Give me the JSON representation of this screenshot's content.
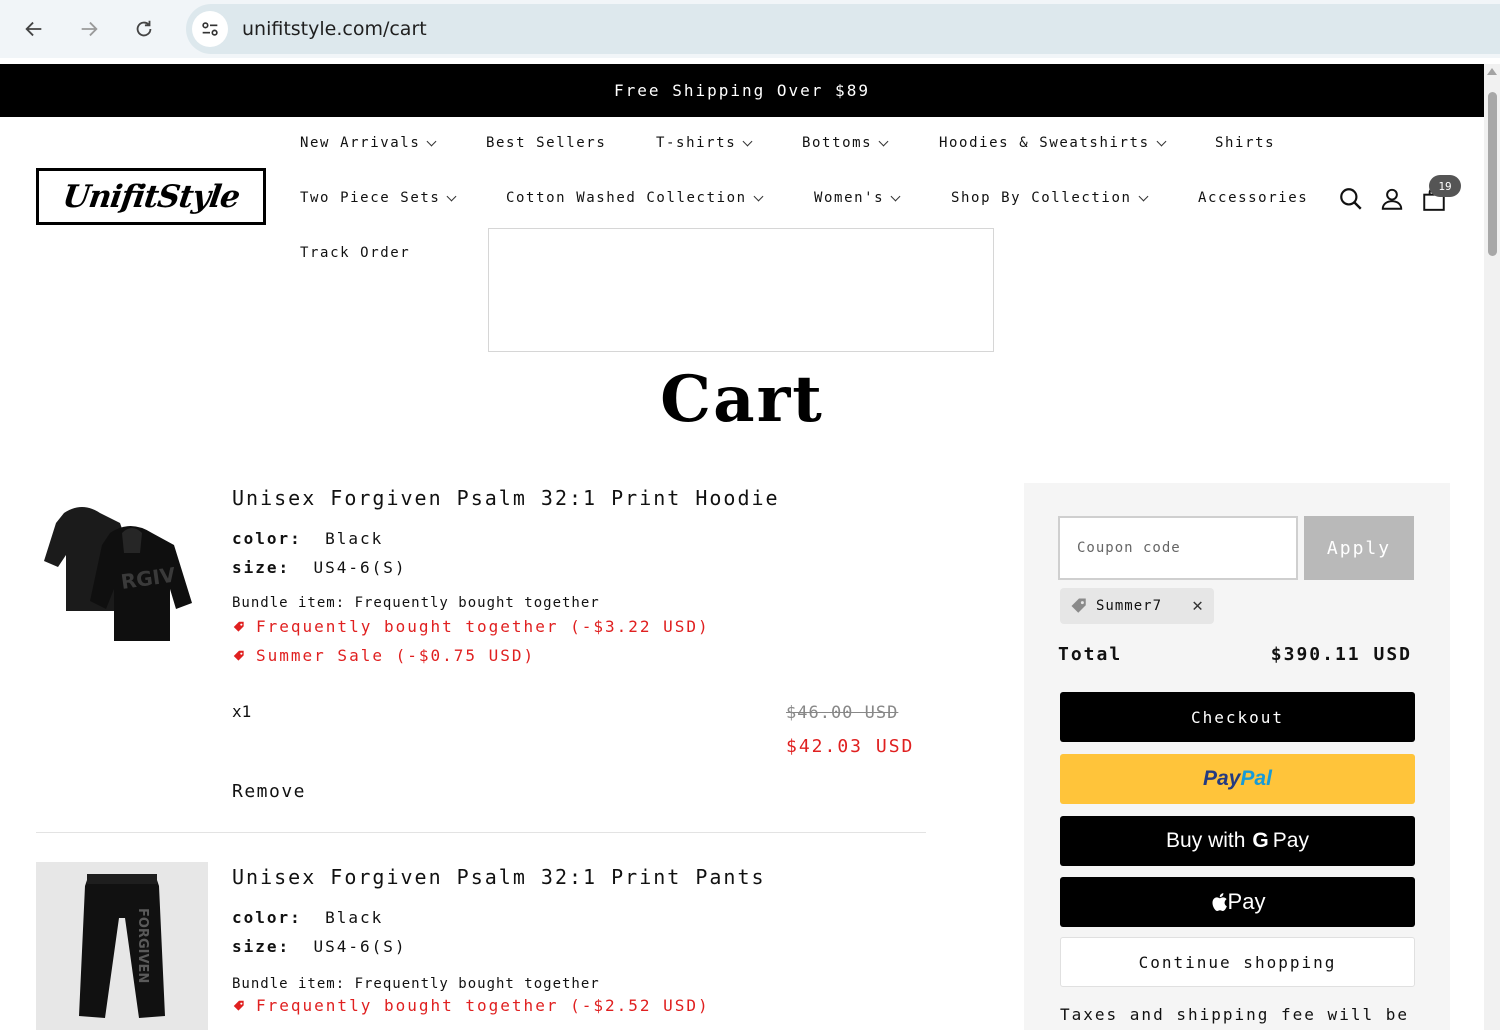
{
  "browser": {
    "url": "unifitstyle.com/cart"
  },
  "announcement": "Free Shipping Over $89",
  "header": {
    "logo": "UnifitStyle",
    "menu": {
      "new_arrivals": "New Arrivals",
      "best_sellers": "Best Sellers",
      "tshirts": "T-shirts",
      "bottoms": "Bottoms",
      "hoodies": "Hoodies & Sweatshirts",
      "shirts": "Shirts",
      "two_piece": "Two Piece Sets",
      "cotton_washed": "Cotton Washed Collection",
      "womens": "Women's",
      "shop_by_collection": "Shop By Collection",
      "accessories": "Accessories",
      "track_order": "Track Order"
    },
    "cart_count": "19"
  },
  "page_title": "Cart",
  "items": [
    {
      "title": "Unisex Forgiven Psalm 32:1 Print Hoodie",
      "color_label": "color:",
      "color_value": "Black",
      "size_label": "size:",
      "size_value": "US4-6(S)",
      "bundle": "Bundle item: Frequently bought together",
      "discount_1": "Frequently bought together (-$3.22 USD)",
      "discount_2": "Summer Sale (-$0.75 USD)",
      "qty": "x1",
      "price_old": "$46.00 USD",
      "price_new": "$42.03 USD",
      "remove": "Remove"
    },
    {
      "title": "Unisex Forgiven Psalm 32:1 Print Pants",
      "color_label": "color:",
      "color_value": "Black",
      "size_label": "size:",
      "size_value": "US4-6(S)",
      "bundle": "Bundle item: Frequently bought together",
      "discount_1": "Frequently bought together (-$2.52 USD)"
    }
  ],
  "summary": {
    "coupon_placeholder": "Coupon code",
    "apply": "Apply",
    "applied_code": "Summer7",
    "total_label": "Total",
    "total_value": "$390.11 USD",
    "checkout": "Checkout",
    "paypal_a": "Pay",
    "paypal_b": "Pal",
    "gpay_prefix": "Buy with",
    "gpay_g": "G",
    "gpay_pay": "Pay",
    "apple_pay": "Pay",
    "continue": "Continue shopping",
    "tax_note": "Taxes and shipping fee will be"
  },
  "colors": {
    "accent_red": "#e02020",
    "paypal_yellow": "#ffc43a",
    "black": "#000000"
  }
}
